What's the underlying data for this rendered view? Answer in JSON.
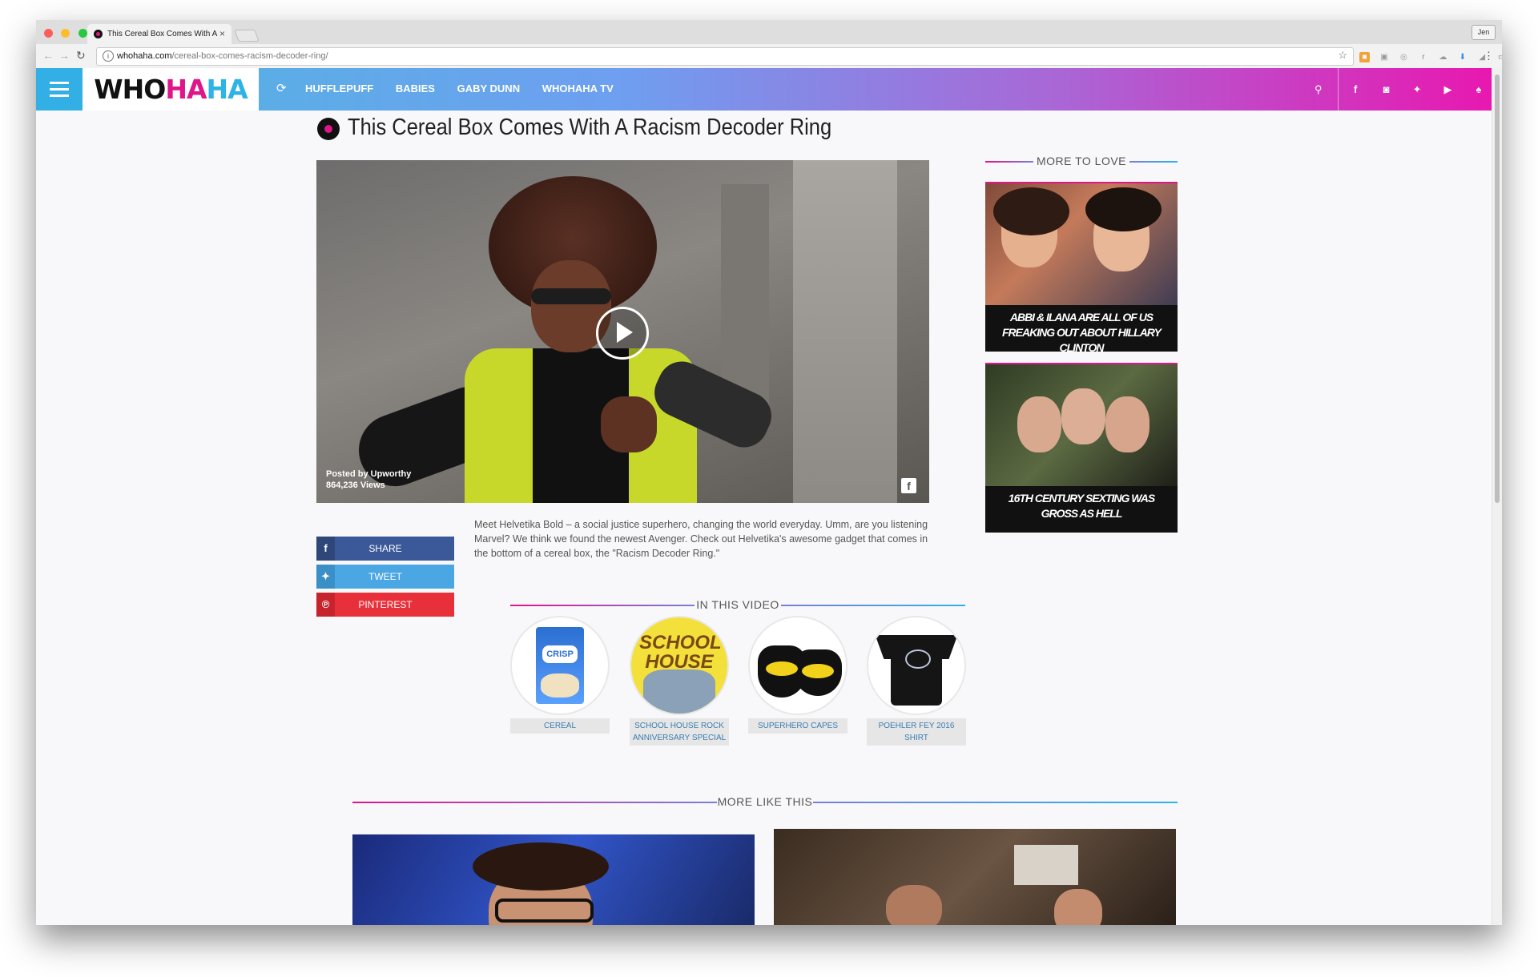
{
  "browser": {
    "tab_title": "This Cereal Box Comes With A",
    "tab_close": "×",
    "url_domain": "whohaha.com",
    "url_path": "/cereal-box-comes-racism-decoder-ring/",
    "profile": "Jen"
  },
  "site": {
    "logo_who": "WHO",
    "logo_ha1": "HA",
    "logo_ha2": "HA",
    "nav": [
      "HUFFLEPUFF",
      "BABIES",
      "GABY DUNN",
      "WHOHAHA TV"
    ],
    "accent_pink": "#e0158a",
    "accent_blue": "#2eb3e6"
  },
  "article": {
    "title": "This Cereal Box Comes With A Racism Decoder Ring",
    "posted_by": "Posted by Upworthy",
    "views": "864,236 Views",
    "description": "Meet Helvetika Bold – a social justice superhero, changing the world everyday. Umm, are you listening Marvel? We think we found the newest Avenger. Check out Helvetika's awesome gadget that comes in the bottom of a cereal box, the \"Racism Decoder Ring.\""
  },
  "share": {
    "facebook": "SHARE",
    "twitter": "TWEET",
    "pinterest": "PINTEREST"
  },
  "in_this_video": {
    "heading": "IN THIS VIDEO",
    "products": [
      {
        "label": "CEREAL"
      },
      {
        "label": "SCHOOL HOUSE ROCK ANNIVERSARY SPECIAL"
      },
      {
        "label": "SUPERHERO CAPES"
      },
      {
        "label": "POEHLER FEY 2016 SHIRT"
      }
    ]
  },
  "sidebar": {
    "heading": "MORE TO LOVE",
    "cards": [
      {
        "caption": "ABBI & ILANA ARE ALL OF US FREAKING OUT ABOUT HILLARY CLINTON"
      },
      {
        "caption": "16TH CENTURY SEXTING WAS GROSS AS HELL"
      }
    ]
  },
  "more_like_this": {
    "heading": "MORE LIKE THIS"
  }
}
